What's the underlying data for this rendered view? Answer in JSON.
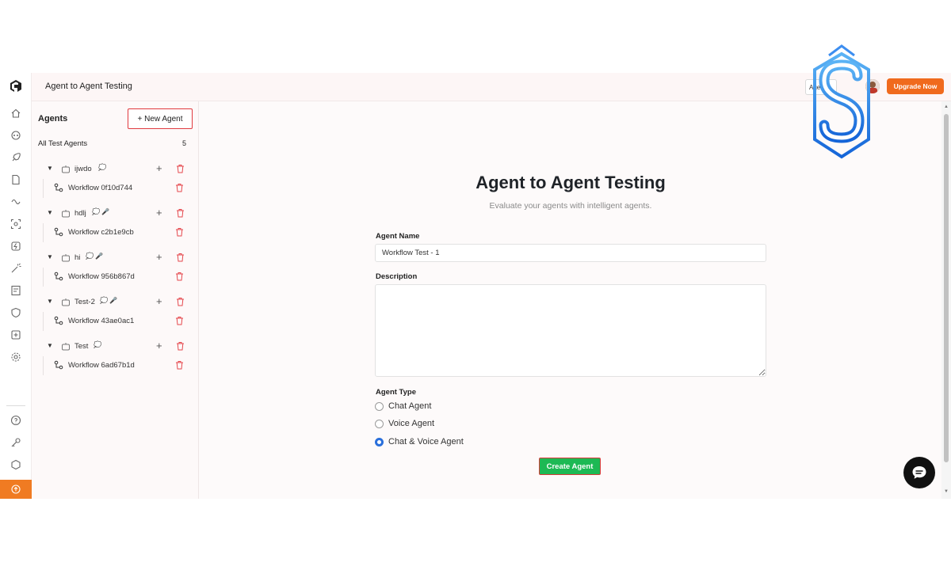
{
  "header": {
    "title": "Agent to Agent Testing",
    "agent_chip": "Agent",
    "upgrade_label": "Upgrade Now"
  },
  "panel": {
    "title": "Agents",
    "new_agent_label": "+ New Agent",
    "all_label": "All Test Agents",
    "count": "5",
    "agents": [
      {
        "name": "ijwdo",
        "badges": "💭",
        "workflow": "Workflow 0f10d744"
      },
      {
        "name": "hdlj",
        "badges": "💭 🎤",
        "workflow": "Workflow c2b1e9cb"
      },
      {
        "name": "hi",
        "badges": "💭 🎤",
        "workflow": "Workflow 956b867d"
      },
      {
        "name": "Test-2",
        "badges": "💭 🎤",
        "workflow": "Workflow 43ae0ac1"
      },
      {
        "name": "Test",
        "badges": "💭",
        "workflow": "Workflow 6ad67b1d"
      }
    ]
  },
  "form": {
    "heading": "Agent to Agent Testing",
    "subheading": "Evaluate your agents with intelligent agents.",
    "name_label": "Agent Name",
    "name_value": "Workflow Test - 1",
    "description_label": "Description",
    "type_label": "Agent Type",
    "types": [
      "Chat Agent",
      "Voice Agent",
      "Chat & Voice Agent"
    ],
    "selected_type": "Chat & Voice Agent",
    "create_label": "Create Agent"
  },
  "colors": {
    "accent_orange": "#f06a1d",
    "create_green": "#1db954",
    "highlight_red": "#e0393e",
    "radio_blue": "#2a6fdb"
  }
}
